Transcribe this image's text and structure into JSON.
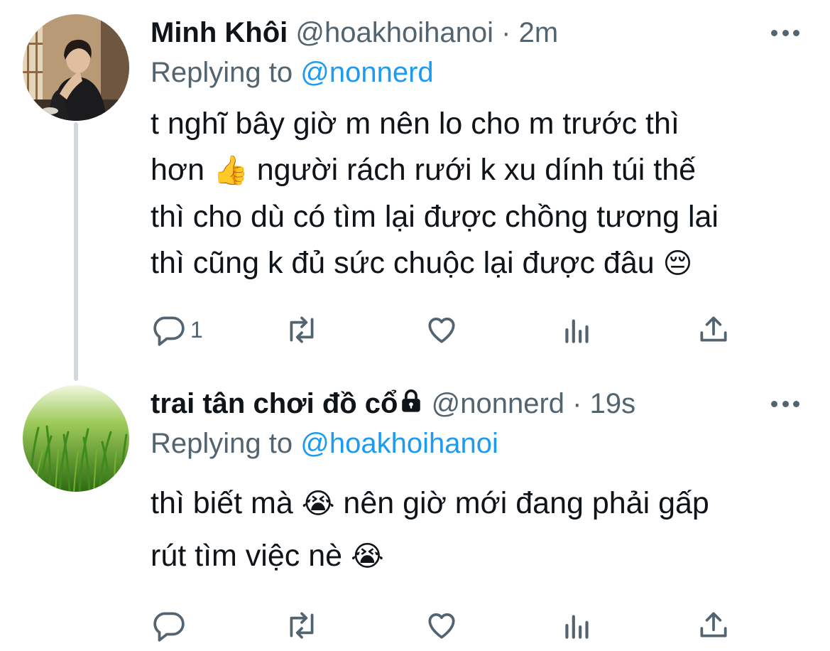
{
  "tweets": [
    {
      "display_name": "Minh Khôi",
      "handle": "@hoakhoihanoi",
      "separator": "·",
      "time": "2m",
      "replying_prefix": "Replying to",
      "replying_to": "@nonnerd",
      "avatar": "person-photo",
      "text_lines": [
        "t nghĩ bây giờ m nên lo cho m trước thì",
        "hơn",
        "người rách rưới k xu dính túi thế",
        "thì cho dù có tìm lại được chồng tương lai",
        "thì cũng k đủ sức chuộc lại được đâu"
      ],
      "emojis": [
        "👍",
        "😔"
      ],
      "reply_count": "1",
      "icons": [
        "reply-icon",
        "retweet-icon",
        "like-icon",
        "analytics-icon",
        "share-icon",
        "more-icon"
      ]
    },
    {
      "display_name": "trai tân chơi đồ cổ",
      "protected": true,
      "handle": "@nonnerd",
      "separator": "·",
      "time": "19s",
      "replying_prefix": "Replying to",
      "replying_to": "@hoakhoihanoi",
      "avatar": "grass-photo",
      "text_lines": [
        "thì biết mà",
        "nên giờ mới đang phải gấp",
        "rút tìm việc nè"
      ],
      "emojis": [
        "😭",
        "😭"
      ],
      "reply_count": "",
      "icons": [
        "reply-icon",
        "retweet-icon",
        "like-icon",
        "analytics-icon",
        "share-icon",
        "more-icon",
        "lock-icon"
      ]
    }
  ],
  "colors": {
    "text": "#0f1419",
    "secondary": "#536471",
    "link": "#1d9bf0",
    "thread_line": "#cfd9de"
  }
}
